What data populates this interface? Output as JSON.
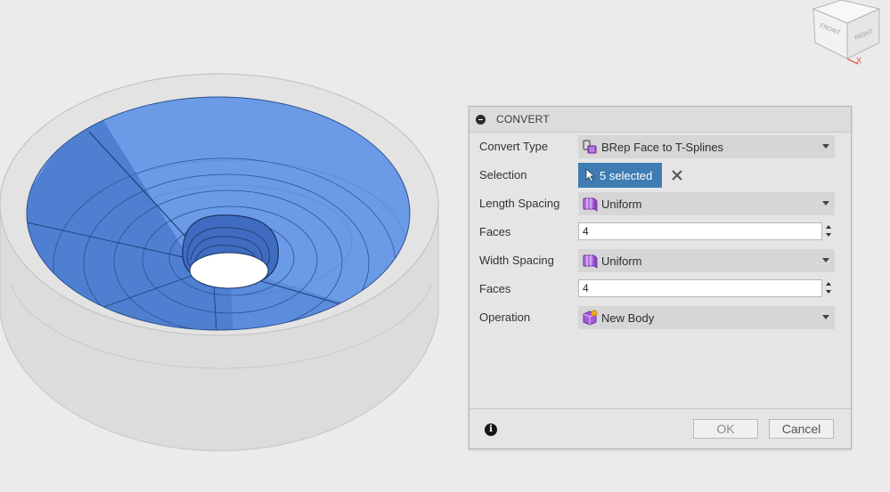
{
  "dialog": {
    "title": "CONVERT",
    "rows": {
      "convert_type": {
        "label": "Convert Type",
        "value": "BRep Face to T-Splines",
        "icon": "brep-tspline-icon"
      },
      "selection": {
        "label": "Selection",
        "value": "5 selected",
        "icon": "cursor-icon"
      },
      "length_spacing": {
        "label": "Length Spacing",
        "value": "Uniform",
        "icon": "uniform-spacing-icon"
      },
      "faces_length": {
        "label": "Faces",
        "value": "4"
      },
      "width_spacing": {
        "label": "Width Spacing",
        "value": "Uniform",
        "icon": "uniform-spacing-icon"
      },
      "faces_width": {
        "label": "Faces",
        "value": "4"
      },
      "operation": {
        "label": "Operation",
        "value": "New Body",
        "icon": "new-body-icon"
      }
    },
    "footer": {
      "ok_label": "OK",
      "cancel_label": "Cancel"
    }
  },
  "viewcube": {
    "face_front": "FRONT",
    "face_right": "RIGHT",
    "axis_label": "X"
  },
  "colors": {
    "selection_face": "#6b9be6",
    "selection_button": "#3e7cb1",
    "background": "#ebebeb"
  }
}
